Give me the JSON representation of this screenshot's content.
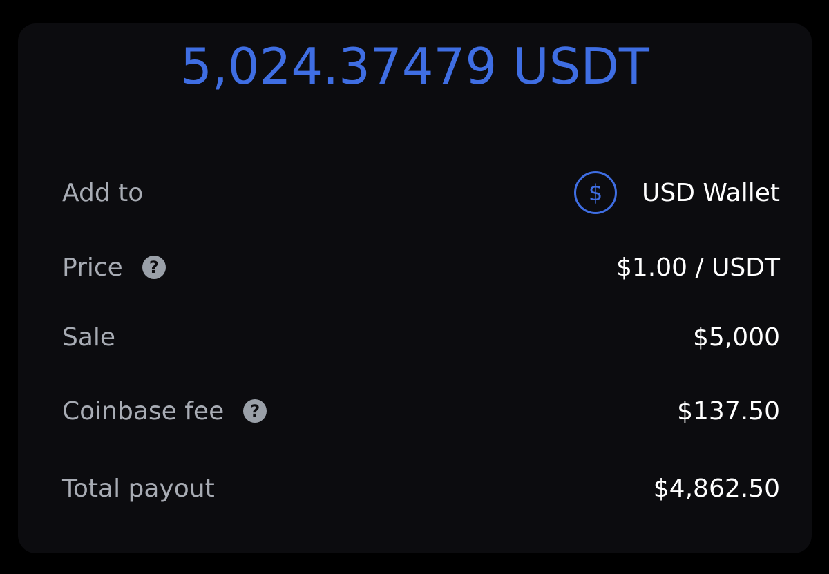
{
  "amount": {
    "text": "5,024.37479 USDT",
    "color": "#3f6ee3"
  },
  "rows": [
    {
      "label": "Add to",
      "value": "USD Wallet",
      "icon": "dollar-circle-icon"
    },
    {
      "label": "Price",
      "value": "$1.00 / USDT",
      "help_icon": "question-mark-icon"
    },
    {
      "label": "Sale",
      "value": "$5,000"
    },
    {
      "label": "Coinbase fee",
      "value": "$137.50",
      "help_icon": "question-mark-icon"
    },
    {
      "label": "Total payout",
      "value": "$4,862.50"
    }
  ],
  "icons": {
    "wallet": "$",
    "help": "?"
  },
  "colors": {
    "background": "#000000",
    "card": "#0c0c0f",
    "label": "#a8acb4",
    "value": "#ffffff",
    "accent": "#3f6ee3"
  }
}
